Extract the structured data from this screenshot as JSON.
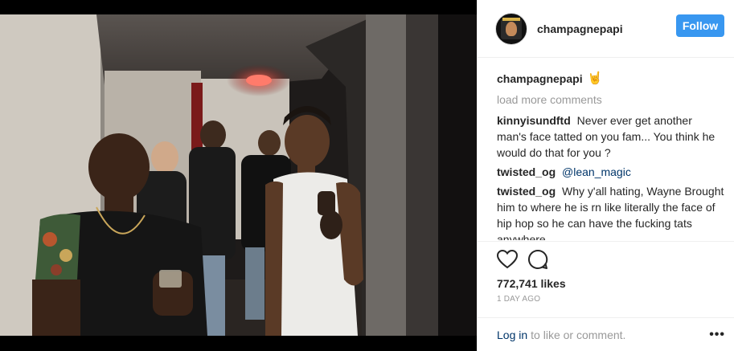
{
  "header": {
    "username": "champagnepapi",
    "follow_label": "Follow"
  },
  "caption": {
    "username": "champagnepapi",
    "emoji": "🤘"
  },
  "load_more_label": "load more comments",
  "comments": [
    {
      "user": "kinnyisundftd",
      "text": "Never ever get another man's face tatted on you fam... You think he would do that for you ?"
    },
    {
      "user": "twisted_og",
      "mention": "@lean_magic"
    },
    {
      "user": "twisted_og",
      "text": "Why y'all hating, Wayne Brought him to where he is rn like literally the face of hip hop so he can have the fucking tats anywhere"
    }
  ],
  "likes": "772,741 likes",
  "time": "1 DAY AGO",
  "footer": {
    "login_label": "Log in",
    "rest_label": "to like or comment."
  },
  "icons": {
    "like": "heart-icon",
    "comment": "comment-icon",
    "more": "more-options-icon"
  }
}
